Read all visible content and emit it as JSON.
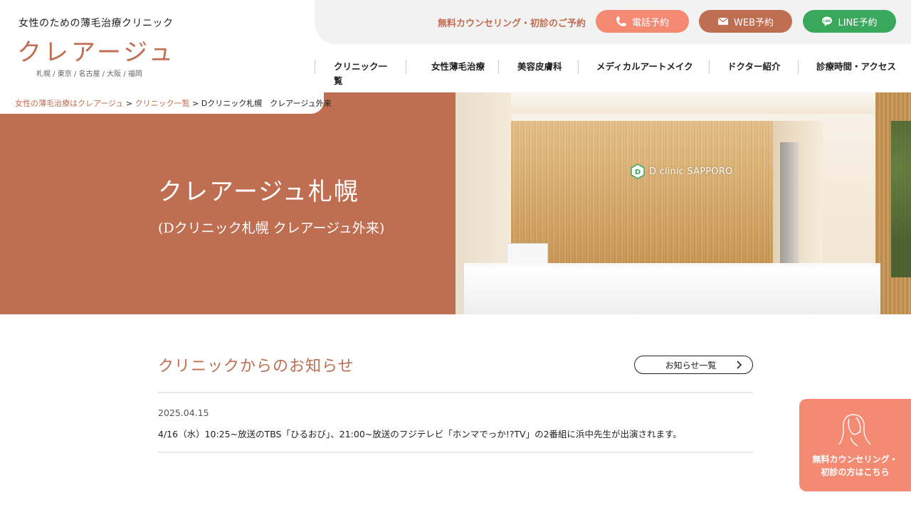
{
  "header": {
    "tagline": "女性のための薄毛治療クリニック",
    "logo": "クレアージュ",
    "cities": "札幌 / 東京 / 名古屋 / 大阪 / 福岡"
  },
  "topbar": {
    "counsel_text": "無料カウンセリング・初診のご予約",
    "phone_label": "電話予約",
    "web_label": "WEB予約",
    "line_label": "LINE予約"
  },
  "nav": {
    "items": [
      {
        "label": "クリニック一覧"
      },
      {
        "label": "女性薄毛治療"
      },
      {
        "label": "美容皮膚科"
      },
      {
        "label": "メディカルアートメイク"
      },
      {
        "label": "ドクター紹介"
      },
      {
        "label": "診療時間・アクセス"
      }
    ]
  },
  "breadcrumb": {
    "home": "女性の薄毛治療はクレアージュ",
    "sep1": " > ",
    "list": "クリニック一覧",
    "sep2": " > ",
    "current": "Dクリニック札幌　クレアージュ外来"
  },
  "hero": {
    "title": "クレアージュ札幌",
    "subtitle": "(Dクリニック札幌 クレアージュ外来)",
    "sign_text": "D clinic SAPPORO"
  },
  "news": {
    "title": "クリニックからのお知らせ",
    "list_button": "お知らせ一覧",
    "items": [
      {
        "date": "2025.04.15",
        "text": "4/16（水）10:25~放送のTBS「ひるおび」、21:00~放送のフジテレビ「ホンマでっか!?TV」の2番組に浜中先生が出演されます。"
      }
    ]
  },
  "float_cta": {
    "line1": "無料カウンセリング・",
    "line2": "初診の方はこちら"
  },
  "colors": {
    "brand": "#c06e52",
    "coral": "#f58a73",
    "line_green": "#3aa85c"
  },
  "icons": [
    "phone-icon",
    "mail-icon",
    "line-icon",
    "chevron-right-icon",
    "woman-face-icon",
    "clinic-d-logo-icon"
  ]
}
